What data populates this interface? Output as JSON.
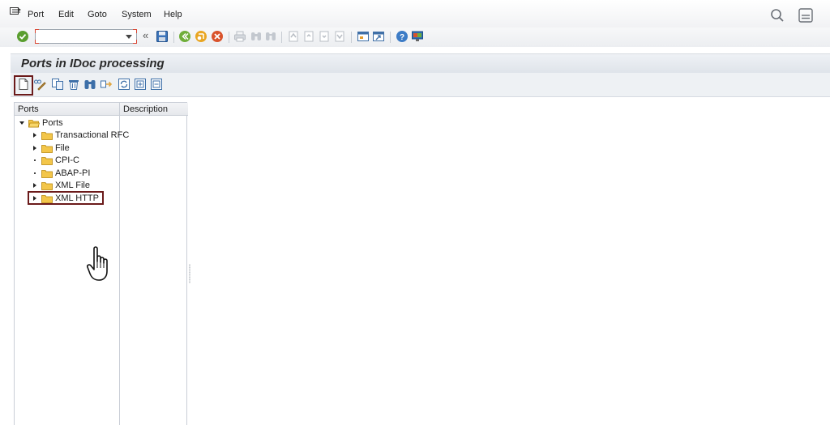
{
  "menu": {
    "items": [
      {
        "id": "port",
        "label": "Port"
      },
      {
        "id": "edit",
        "label": "Edit"
      },
      {
        "id": "goto",
        "label": "Goto"
      },
      {
        "id": "system",
        "label": "System"
      },
      {
        "id": "help",
        "label": "Help"
      }
    ]
  },
  "toolbar": {
    "command_field": {
      "value": "",
      "placeholder": ""
    },
    "expand_glyph": "«"
  },
  "page": {
    "title": "Ports in IDoc processing"
  },
  "tree": {
    "columns": {
      "ports": "Ports",
      "description": "Description"
    },
    "root": {
      "label": "Ports",
      "expanded": true
    },
    "children": [
      {
        "label": "Transactional RFC",
        "toggle": "collapsed"
      },
      {
        "label": "File",
        "toggle": "collapsed"
      },
      {
        "label": "CPI-C",
        "toggle": "leaf"
      },
      {
        "label": "ABAP-PI",
        "toggle": "leaf"
      },
      {
        "label": "XML File",
        "toggle": "collapsed"
      },
      {
        "label": "XML HTTP",
        "toggle": "collapsed",
        "highlighted": true
      }
    ]
  },
  "highlights": {
    "border_color": "#6b1a1a",
    "targets": [
      "create-button",
      "XML HTTP"
    ]
  },
  "colors": {
    "ok_green": "#5a9e2f",
    "folder_yellow": "#f3c64a",
    "accent_blue": "#2f6fb5",
    "cancel_red": "#d9532c"
  }
}
